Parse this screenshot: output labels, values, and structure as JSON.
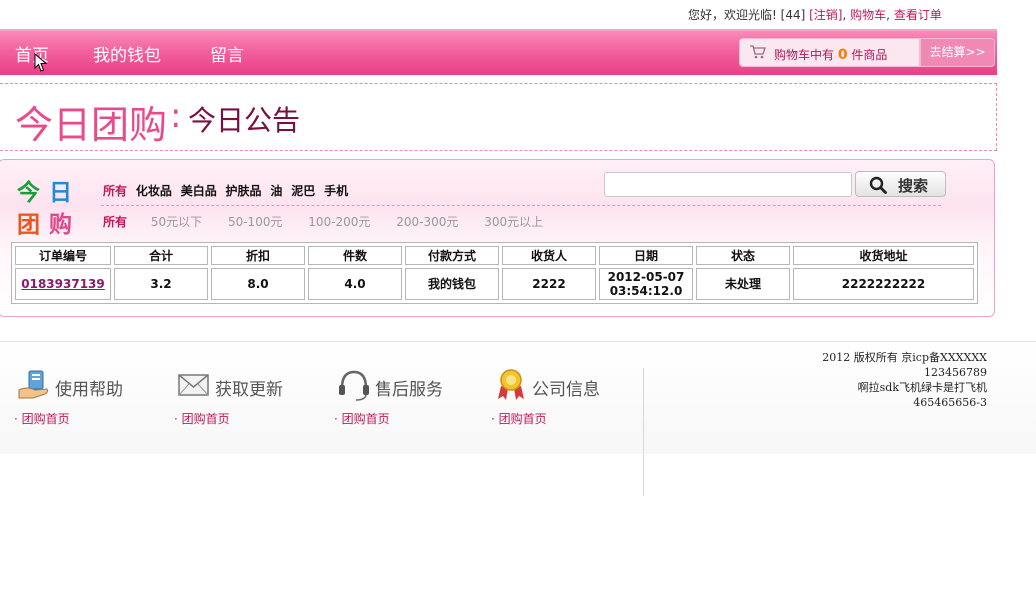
{
  "topbar": {
    "welcome": "您好，欢迎光临!",
    "user_id": "[44]",
    "logout": "[注销]",
    "cart_link": "购物车",
    "orders_link": "查看订单"
  },
  "nav": {
    "items": [
      "首页",
      "我的钱包",
      "留言"
    ],
    "cart_prefix": "购物车中有",
    "cart_count": "0",
    "cart_suffix": "件商品",
    "checkout": "去结算>>"
  },
  "notice": {
    "title": "今日团购",
    "sep": ":",
    "subtitle": "今日公告"
  },
  "logo": {
    "chars": [
      "今",
      "日",
      "团",
      "购"
    ],
    "colors": [
      "#1a9e3a",
      "#1f8ad6",
      "#e8581c",
      "#e04a8d"
    ]
  },
  "filters": {
    "all": "所有",
    "categories": [
      "化妆品",
      "美白品",
      "护肤品",
      "油",
      "泥巴",
      "手机"
    ],
    "price_all": "所有",
    "prices": [
      "50元以下",
      "50-100元",
      "100-200元",
      "200-300元",
      "300元以上"
    ]
  },
  "search": {
    "value": "",
    "button": "搜索"
  },
  "orders": {
    "headers": [
      "订单编号",
      "合计",
      "折扣",
      "件数",
      "付款方式",
      "收货人",
      "日期",
      "状态",
      "收货地址"
    ],
    "rows": [
      {
        "order_id": "0183937139",
        "total": "3.2",
        "discount": "8.0",
        "count": "4.0",
        "payment": "我的钱包",
        "receiver": "2222",
        "date": "2012-05-07",
        "time": "03:54:12.0",
        "status": "未处理",
        "address": "2222222222"
      }
    ]
  },
  "footer": {
    "cols": [
      {
        "title": "使用帮助",
        "link": "· 团购首页"
      },
      {
        "title": "获取更新",
        "link": "· 团购首页"
      },
      {
        "title": "售后服务",
        "link": "· 团购首页"
      },
      {
        "title": "公司信息",
        "link": "· 团购首页"
      }
    ],
    "copyright": [
      "2012 版权所有 京icp备XXXXXX",
      "123456789",
      "啊拉sdk飞机绿卡是打飞机",
      "465465656-3"
    ]
  },
  "colors": {
    "accent": "#ea4a8c",
    "nav_bg": "#f3619f"
  }
}
